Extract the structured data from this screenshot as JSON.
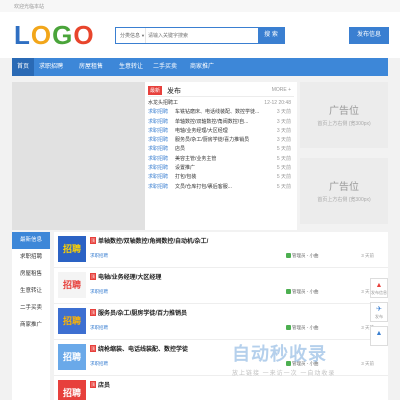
{
  "topbar": {
    "welcome": "欢迎光临本站"
  },
  "logo": [
    "L",
    "O",
    "G",
    "O"
  ],
  "search": {
    "category": "分类信息",
    "placeholder": "请输入关键字搜索",
    "button": "搜 索"
  },
  "post_button": "发布信息",
  "nav": [
    "首页",
    "求职招聘",
    "房屋租售",
    "生意转让",
    "二手买卖",
    "商家推广"
  ],
  "news": {
    "tag": "最新",
    "title": "发布",
    "more": "MORE +",
    "items": [
      {
        "cat": "",
        "text": "水龙头招聘工",
        "time": "12-12 20:48"
      },
      {
        "cat": "求职招聘",
        "text": "车铣钻磨床、电话线装配、数控学徒...",
        "time": "3 天前"
      },
      {
        "cat": "求职招聘",
        "text": "单轴数控/双轴数控/角阀数控/自...",
        "time": "3 天前"
      },
      {
        "cat": "求职招聘",
        "text": "电轴/业务经理/大区经理",
        "time": "3 天前"
      },
      {
        "cat": "求职招聘",
        "text": "服务员/杂工/厨房学徒/喜力推销员",
        "time": "3 天前"
      },
      {
        "cat": "求职招聘",
        "text": "店员",
        "time": "5 天前"
      },
      {
        "cat": "求职招聘",
        "text": "美容主管/业务主管",
        "time": "5 天前"
      },
      {
        "cat": "求职招聘",
        "text": "设置推广",
        "time": "5 天前"
      },
      {
        "cat": "求职招聘",
        "text": "打包/包装",
        "time": "5 天前"
      },
      {
        "cat": "求职招聘",
        "text": "文员/仓库打包/裹后客服...",
        "time": "5 天前"
      }
    ]
  },
  "ads": [
    {
      "title": "广告位",
      "sub": "首页上方右侧 (宽300px)"
    },
    {
      "title": "广告位",
      "sub": "首页上方右侧 (宽300px)"
    }
  ],
  "side_nav": [
    "最新信息",
    "求职招聘",
    "房屋租售",
    "生意转让",
    "二手买卖",
    "商家推广"
  ],
  "listings": [
    {
      "badge": "顶",
      "title": "单轴数控/双轴数控/角阀数控/自动机/杂工/",
      "cat": "求职招聘",
      "poster": "管理员 - 小曲",
      "time": "3 天前",
      "thumb": "招聘"
    },
    {
      "badge": "顶",
      "title": "电轴/业务经理/大区经理",
      "cat": "求职招聘",
      "poster": "管理员 - 小曲",
      "time": "3 天前",
      "thumb": "招聘"
    },
    {
      "badge": "顶",
      "title": "服务员/杂工/厨房学徒/百力推销员",
      "cat": "求职招聘",
      "poster": "管理员 - 小曲",
      "time": "3 天前",
      "thumb": "招聘"
    },
    {
      "badge": "顶",
      "title": "绕枪缩装、电话线装配、数控学徒",
      "cat": "求职招聘",
      "poster": "管理员 - 小曲",
      "time": "3 天前",
      "thumb": "招聘"
    },
    {
      "badge": "顶",
      "title": "店员",
      "cat": "",
      "poster": "",
      "time": "",
      "thumb": "招聘"
    }
  ],
  "float_bar": [
    {
      "icon": "▲",
      "label": "发布信息"
    },
    {
      "icon": "✈",
      "label": "发布"
    },
    {
      "icon": "▲",
      "label": ""
    }
  ],
  "watermark": {
    "big": "自动秒收录",
    "small": "放上链接 一来访一次 一自动收录"
  },
  "colors": {
    "primary": "#3d87d8",
    "nav_active": "#2a6ab5",
    "badge": "#e7403c"
  }
}
